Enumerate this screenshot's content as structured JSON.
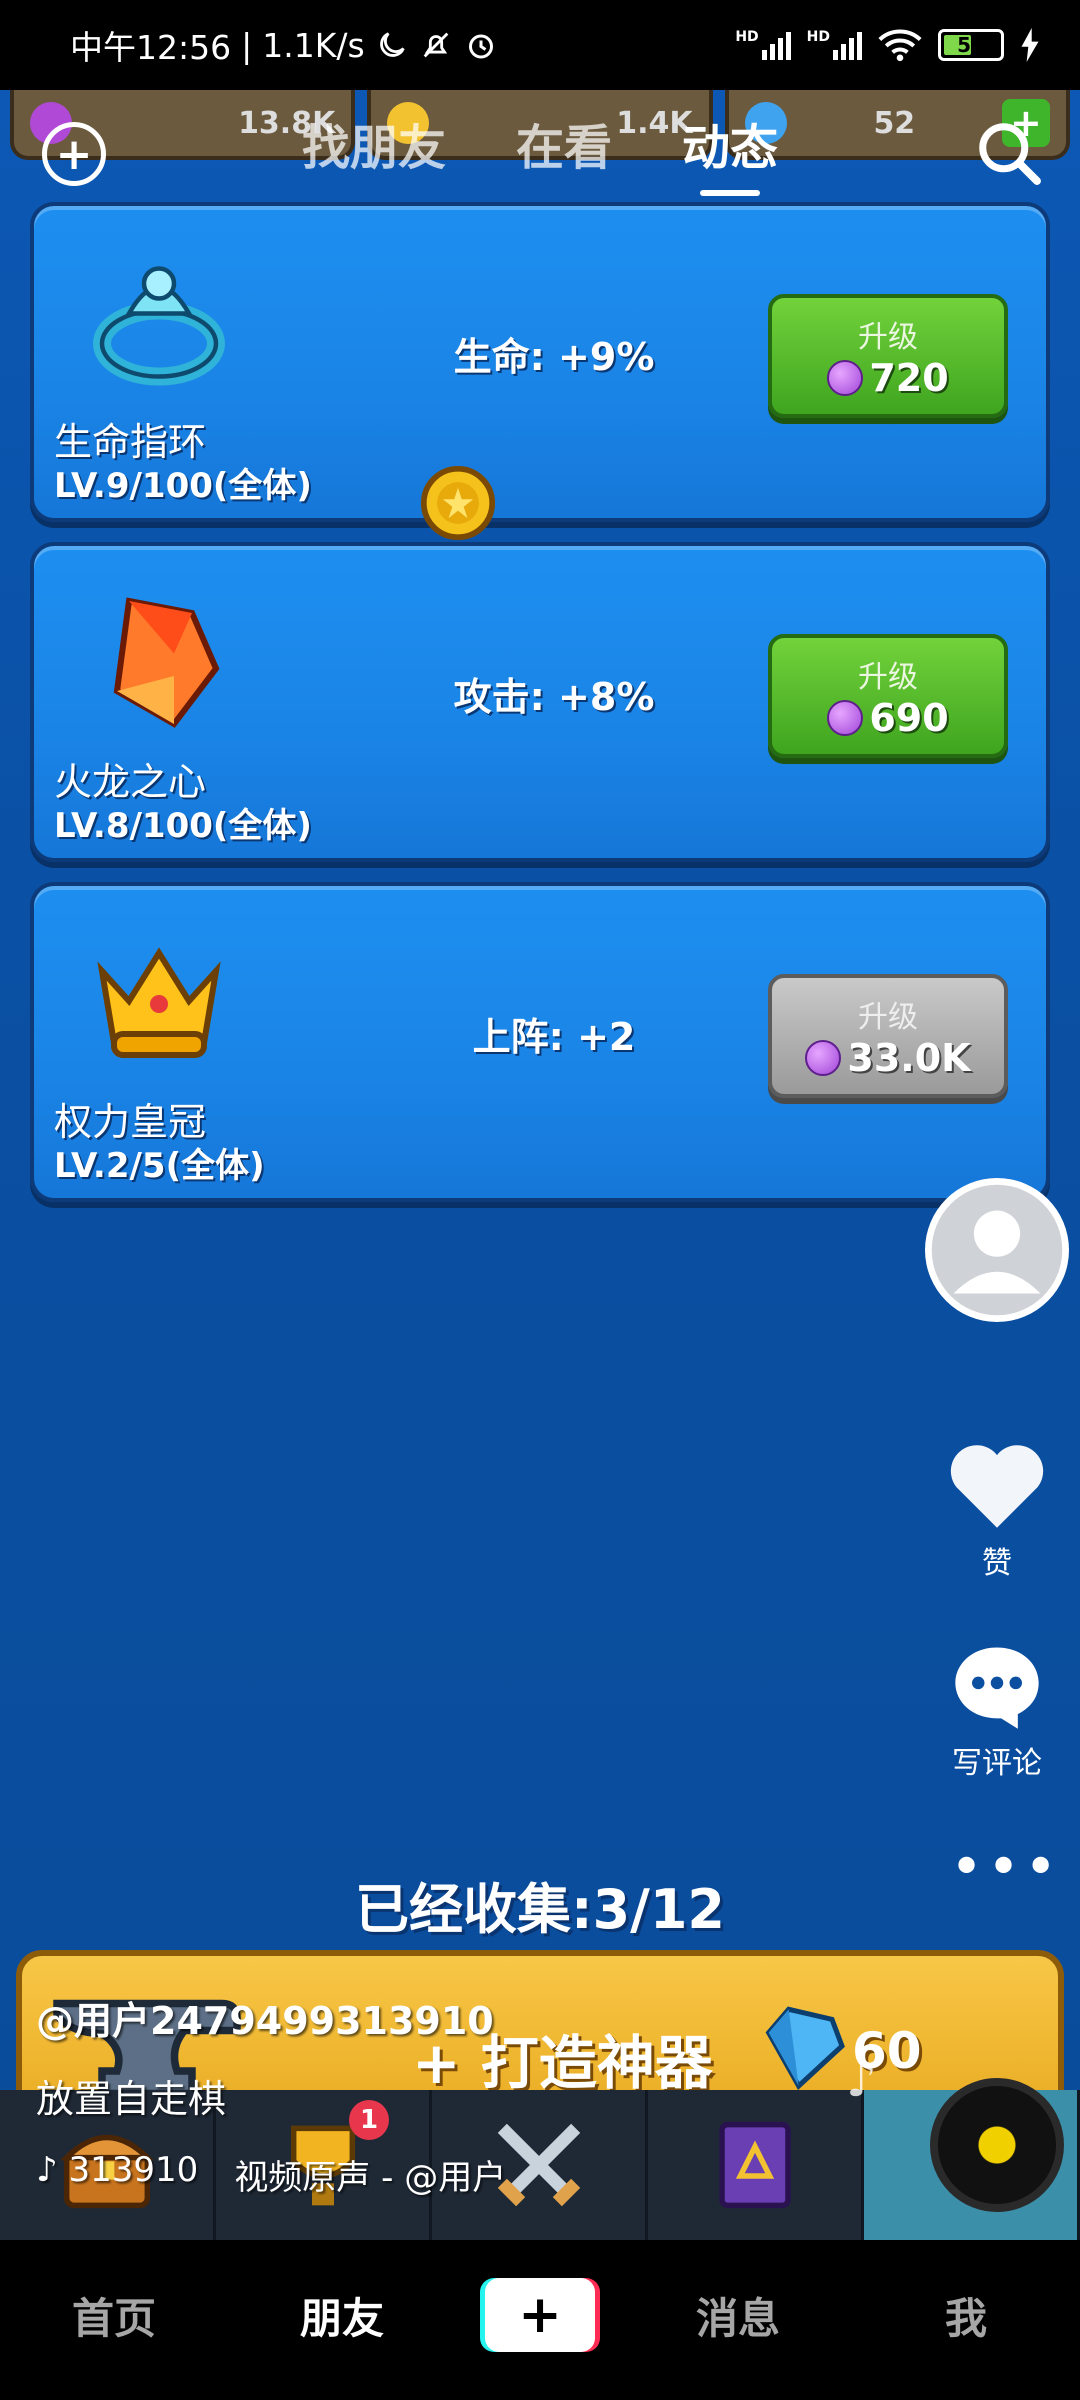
{
  "status_bar": {
    "time": "中午12:56",
    "net_speed": "1.1K/s",
    "battery": "51"
  },
  "resources": [
    {
      "value": "13.8K",
      "color": "#b04ad6"
    },
    {
      "value": "1.4K",
      "color": "#f2c230"
    },
    {
      "value": "52",
      "color": "#3fa3f0"
    }
  ],
  "top_nav": {
    "tabs": [
      "找朋友",
      "在看",
      "动态"
    ],
    "active_tab": "动态"
  },
  "artifacts": [
    {
      "name": "生命指环",
      "level": "LV.9/100(全体)",
      "stat": "生命: +9%",
      "upgrade_label": "升级",
      "cost": "720",
      "enabled": true
    },
    {
      "name": "火龙之心",
      "level": "LV.8/100(全体)",
      "stat": "攻击: +8%",
      "upgrade_label": "升级",
      "cost": "690",
      "enabled": true
    },
    {
      "name": "权力皇冠",
      "level": "LV.2/5(全体)",
      "stat": "上阵: +2",
      "upgrade_label": "升级",
      "cost": "33.0K",
      "enabled": false
    }
  ],
  "collection": "已经收集:3/12",
  "forge": {
    "label": "+ 打造神器",
    "cost": "60"
  },
  "tray": {
    "badge": "1"
  },
  "side": {
    "like_label": "赞",
    "comment_label": "写评论"
  },
  "post": {
    "user": "@用户2479499313910",
    "caption": "放置自走棋",
    "likes": "313910",
    "sound": "视频原声 - @用户"
  },
  "bottom_nav": {
    "home": "首页",
    "friends": "朋友",
    "messages": "消息",
    "me": "我"
  }
}
